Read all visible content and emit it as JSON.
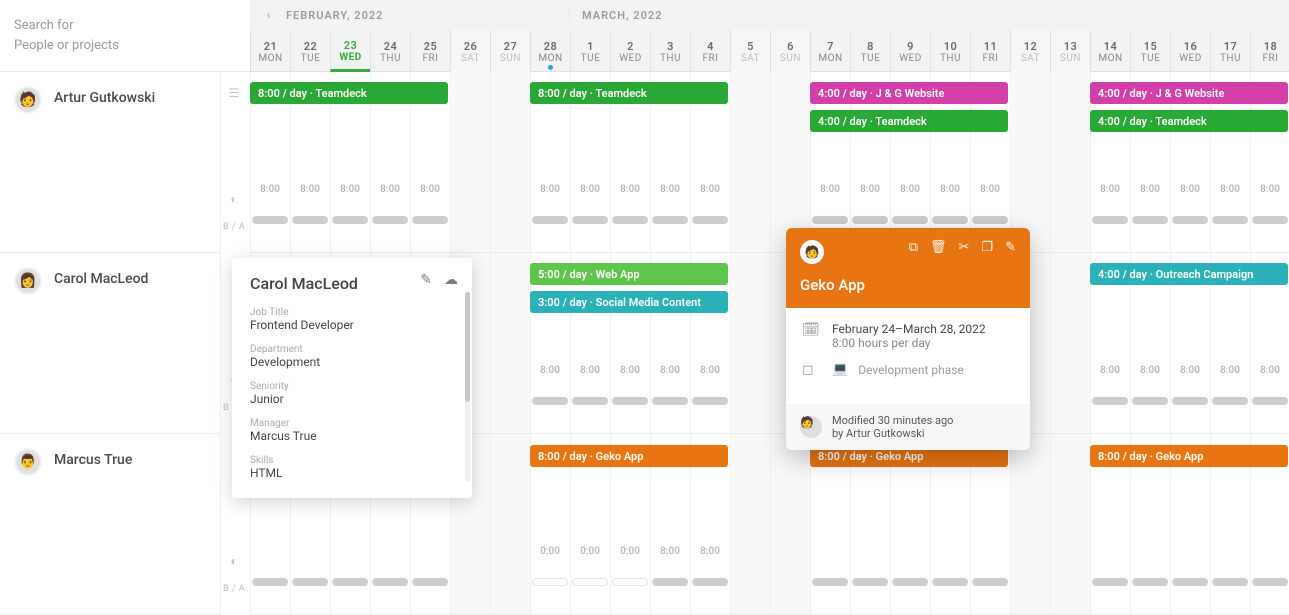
{
  "search": {
    "line1": "Search for",
    "line2": "People or projects"
  },
  "months": {
    "prev_icon": "‹",
    "month1": "FEBRUARY, 2022",
    "month2": "MARCH, 2022"
  },
  "days": [
    {
      "num": "21",
      "wd": "MON",
      "wknd": false,
      "today": false
    },
    {
      "num": "22",
      "wd": "TUE",
      "wknd": false,
      "today": false
    },
    {
      "num": "23",
      "wd": "WED",
      "wknd": false,
      "today": true
    },
    {
      "num": "24",
      "wd": "THU",
      "wknd": false,
      "today": false
    },
    {
      "num": "25",
      "wd": "FRI",
      "wknd": false,
      "today": false
    },
    {
      "num": "26",
      "wd": "SAT",
      "wknd": true,
      "today": false
    },
    {
      "num": "27",
      "wd": "SUN",
      "wknd": true,
      "today": false
    },
    {
      "num": "28",
      "wd": "MON",
      "wknd": false,
      "today": false,
      "dot": true
    },
    {
      "num": "1",
      "wd": "TUE",
      "wknd": false,
      "today": false
    },
    {
      "num": "2",
      "wd": "WED",
      "wknd": false,
      "today": false
    },
    {
      "num": "3",
      "wd": "THU",
      "wknd": false,
      "today": false
    },
    {
      "num": "4",
      "wd": "FRI",
      "wknd": false,
      "today": false
    },
    {
      "num": "5",
      "wd": "SAT",
      "wknd": true,
      "today": false
    },
    {
      "num": "6",
      "wd": "SUN",
      "wknd": true,
      "today": false
    },
    {
      "num": "7",
      "wd": "MON",
      "wknd": false,
      "today": false
    },
    {
      "num": "8",
      "wd": "TUE",
      "wknd": false,
      "today": false
    },
    {
      "num": "9",
      "wd": "WED",
      "wknd": false,
      "today": false
    },
    {
      "num": "10",
      "wd": "THU",
      "wknd": false,
      "today": false
    },
    {
      "num": "11",
      "wd": "FRI",
      "wknd": false,
      "today": false
    },
    {
      "num": "12",
      "wd": "SAT",
      "wknd": true,
      "today": false
    },
    {
      "num": "13",
      "wd": "SUN",
      "wknd": true,
      "today": false
    },
    {
      "num": "14",
      "wd": "MON",
      "wknd": false,
      "today": false
    },
    {
      "num": "15",
      "wd": "TUE",
      "wknd": false,
      "today": false
    },
    {
      "num": "16",
      "wd": "WED",
      "wknd": false,
      "today": false
    },
    {
      "num": "17",
      "wd": "THU",
      "wknd": false,
      "today": false
    },
    {
      "num": "18",
      "wd": "FRI",
      "wknd": false,
      "today": false
    }
  ],
  "people": [
    {
      "name": "Artur Gutkowski",
      "avatar": "🧑"
    },
    {
      "name": "Carol MacLeod",
      "avatar": "👩"
    },
    {
      "name": "Marcus True",
      "avatar": "👨"
    }
  ],
  "row_icons": {
    "ba_label": "B / A"
  },
  "row0": {
    "hours": [
      "8:00",
      "8:00",
      "8:00",
      "8:00",
      "8:00",
      "",
      "",
      "8:00",
      "8:00",
      "8:00",
      "8:00",
      "8:00",
      "",
      "",
      "8:00",
      "8:00",
      "8:00",
      "8:00",
      "8:00",
      "",
      "",
      "8:00",
      "8:00",
      "8:00",
      "8:00",
      "8:00"
    ],
    "bars": {
      "teamdeck1": "8:00 / day · Teamdeck",
      "teamdeck2": "8:00 / day · Teamdeck",
      "jg1": "4:00 / day · J & G Website",
      "teamdeck3": "4:00 / day · Teamdeck",
      "jg2": "4:00 / day · J & G Website",
      "teamdeck4": "4:00 / day · Teamdeck"
    }
  },
  "row1": {
    "hours": [
      "",
      "",
      "",
      "",
      "",
      "",
      "",
      "8:00",
      "8:00",
      "8:00",
      "8:00",
      "8:00",
      "",
      "",
      "",
      "",
      "",
      "",
      "",
      "",
      "",
      "8:00",
      "8:00",
      "8:00",
      "8:00",
      "8:00"
    ],
    "bars": {
      "webapp": "5:00 / day · Web App",
      "social": "3:00 / day · Social Media Content",
      "outreach": "4:00 / day · Outreach Campaign"
    }
  },
  "row2": {
    "hours": [
      "",
      "",
      "",
      "",
      "",
      "",
      "",
      "0:00",
      "0:00",
      "0:00",
      "8:00",
      "8:00",
      "",
      "",
      "",
      "",
      "",
      "",
      "",
      "",
      "",
      "",
      "",
      "",
      "",
      ""
    ],
    "bars": {
      "geko1": "8:00 / day · Geko App",
      "geko2": "8:00 / day · Geko App",
      "geko3": "8:00 / day · Geko App"
    }
  },
  "detail_card": {
    "name": "Carol MacLeod",
    "fields": {
      "job_title_label": "Job Title",
      "job_title_value": "Frontend Developer",
      "dept_label": "Department",
      "dept_value": "Development",
      "seniority_label": "Seniority",
      "seniority_value": "Junior",
      "manager_label": "Manager",
      "manager_value": "Marcus True",
      "skills_label": "Skills",
      "skills_value": "HTML"
    }
  },
  "popover": {
    "title": "Geko App",
    "date_range": "February 24–March 28, 2022",
    "hours_per_day": "8:00 hours per day",
    "phase": "Development phase",
    "modified_line1": "Modified 30 minutes ago",
    "modified_line2": "by Artur Gutkowski"
  },
  "colors": {
    "green": "#2aa836",
    "lime": "#5cc54a",
    "teal": "#2bb1b8",
    "orange": "#e87511",
    "pink": "#d33fa8"
  }
}
